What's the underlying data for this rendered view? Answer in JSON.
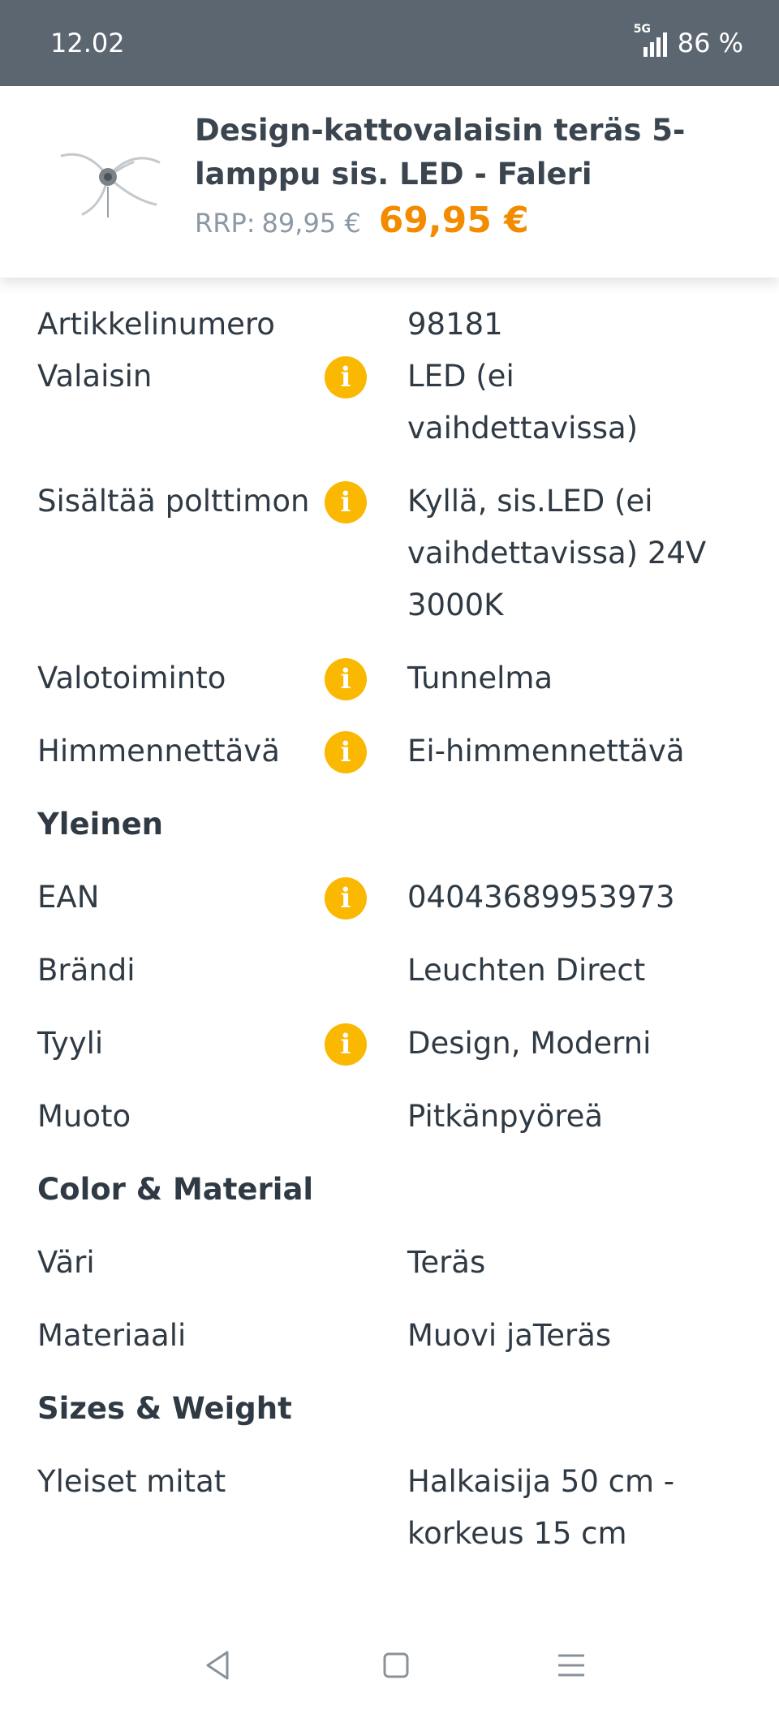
{
  "status": {
    "time": "12.02",
    "network": "5G",
    "battery": "86 %"
  },
  "product": {
    "title": "Design-kattovalaisin teräs 5-lamppu sis. LED - Faleri",
    "rrp_label": "RRP:",
    "rrp_price": "89,95 €",
    "price": "69,95 €"
  },
  "specs": [
    {
      "label": "Artikkelinumero",
      "value": "98181"
    },
    {
      "label": "Valaisin",
      "value": "LED (ei vaihdettavissa)",
      "info": true
    },
    {
      "label": "Sisältää polttimon",
      "value": "Kyllä, sis.LED (ei vaihdettavissa) 24V 3000K",
      "info": true
    },
    {
      "label": "Valotoiminto",
      "value": "Tunnelma",
      "info": true
    },
    {
      "label": "Himmennettävä",
      "value": "Ei-himmennettävä",
      "info": true
    }
  ],
  "section_general": "Yleinen",
  "general": [
    {
      "label": "EAN",
      "value": "04043689953973",
      "info": true
    },
    {
      "label": "Brändi",
      "value": "Leuchten Direct"
    },
    {
      "label": "Tyyli",
      "value": "Design, Moderni",
      "info": true
    },
    {
      "label": "Muoto",
      "value": "Pitkänpyöreä"
    }
  ],
  "section_color": "Color & Material",
  "color": [
    {
      "label": "Väri",
      "value": "Teräs"
    },
    {
      "label": "Materiaali",
      "value": "Muovi jaTeräs"
    }
  ],
  "section_sizes": "Sizes & Weight",
  "sizes": [
    {
      "label": "Yleiset mitat",
      "value": "Halkaisija 50 cm - korkeus 15 cm"
    }
  ],
  "info_icon_glyph": "i",
  "colors": {
    "statusbar": "#5c6670",
    "price": "#f38b00",
    "info": "#fbb800",
    "text": "#2f3a44"
  },
  "icons": {
    "back": "triangle-back-icon",
    "home": "square-home-icon",
    "menu": "menu-lines-icon"
  }
}
